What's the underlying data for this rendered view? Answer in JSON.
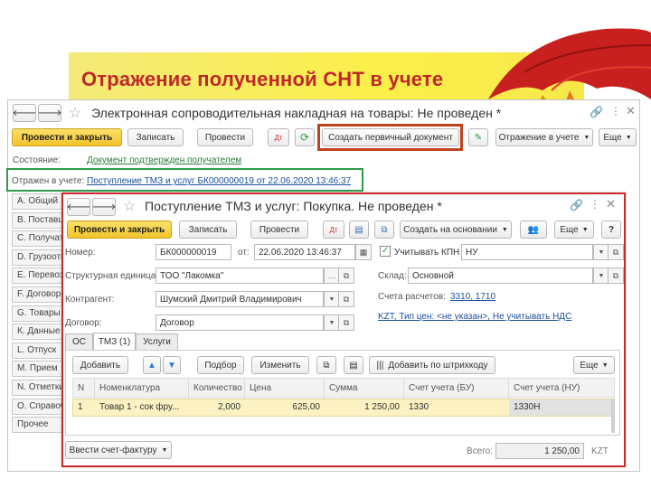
{
  "slide": {
    "title": "Отражение полученной СНТ в учете",
    "title_color": "#c0282a"
  },
  "win1": {
    "title": "Электронная сопроводительная накладная на товары: Не проведен *",
    "buttons": {
      "post_close": "Провести и закрыть",
      "save": "Записать",
      "post": "Провести",
      "create_primary": "Создать первичный документ",
      "reflect": "Отражение в учете",
      "more": "Еще"
    },
    "status_label": "Состояние:",
    "status_value": "Документ подтвержден получателем",
    "reflected_label": "Отражен в учете:",
    "reflected_value": "Поступление ТМЗ и услуг БК000000019 от 22.06.2020 13:46:37",
    "sidebar": [
      "А. Общий",
      "В. Поставщик",
      "С. Получатель",
      "D. Грузоотправ.",
      "Е. Перевозчик",
      "F. Договор",
      "G. Товары",
      "К. Данные",
      "L. Отпуск",
      "М. Прием",
      "N. Отметки",
      "О. Справочн.",
      "Прочее"
    ]
  },
  "win2": {
    "title": "Поступление ТМЗ и услуг: Покупка. Не проведен *",
    "buttons": {
      "post_close": "Провести и закрыть",
      "save": "Записать",
      "post": "Провести",
      "create_base": "Создать на основании",
      "more": "Еще",
      "help": "?"
    },
    "fields": {
      "number_label": "Номер:",
      "number": "БК000000019",
      "date_label": "от:",
      "date": "22.06.2020 13:46:37",
      "kpn_label": "Учитывать КПН",
      "kpn_value": "НУ",
      "unit_label": "Структурная единица:",
      "unit": "ТОО \"Лакомка\"",
      "warehouse_label": "Склад:",
      "warehouse": "Основной",
      "contractor_label": "Контрагент:",
      "contractor": "Шумский Дмитрий Владимирович",
      "accounts_label": "Счета расчетов:",
      "accounts": "3310, 1710",
      "contract_label": "Договор:",
      "contract": "Договор",
      "price_info": "KZT, Тип цен: <не указан>, Не учитывать НДС"
    },
    "tabs": [
      "ОС",
      "ТМЗ (1)",
      "Услуги"
    ],
    "table_toolbar": {
      "add": "Добавить",
      "pick": "Подбор",
      "change": "Изменить",
      "barcode": "Добавить по штрихкоду",
      "more": "Еще"
    },
    "columns": [
      "N",
      "Номенклатура",
      "Количество",
      "Цена",
      "Сумма",
      "Счет учета (БУ)",
      "Счет учета (НУ)"
    ],
    "rows": [
      [
        "1",
        "Товар 1 - сок фру...",
        "2,000",
        "625,00",
        "1 250,00",
        "1330",
        "1330Н"
      ]
    ],
    "invoice_button": "Ввести счет-фактуру",
    "total_label": "Всего:",
    "total": "1 250,00",
    "currency": "KZT"
  }
}
